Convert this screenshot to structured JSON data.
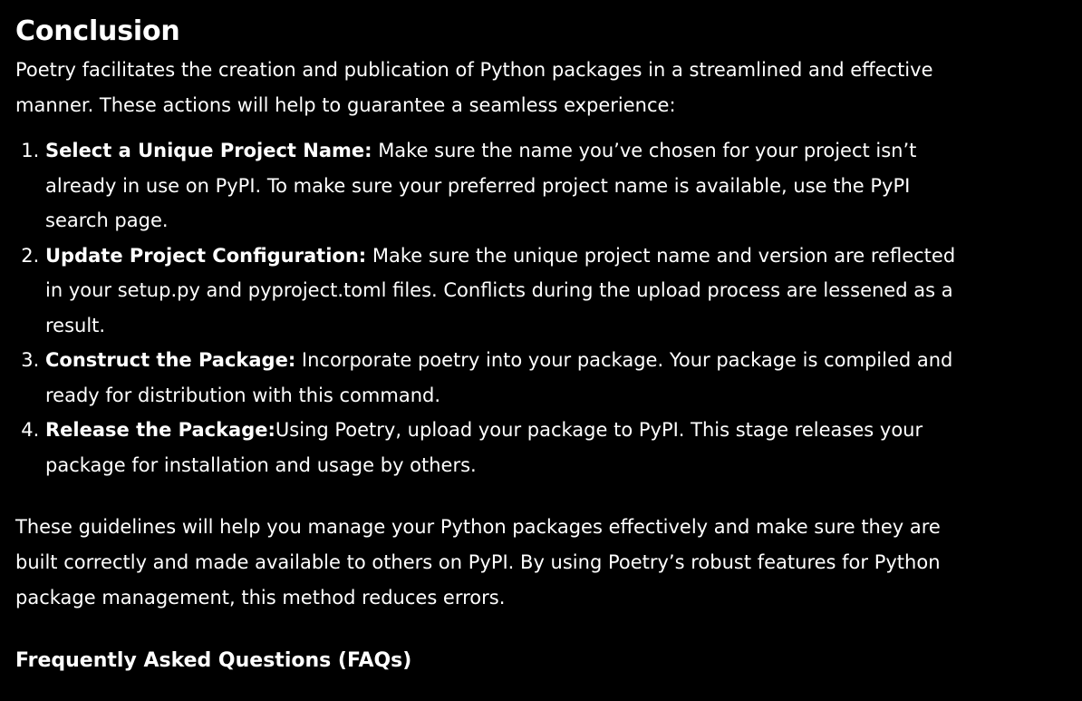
{
  "heading": "Conclusion",
  "intro": "Poetry facilitates the creation and publication of Python packages in a streamlined and effective manner. These actions will help to guarantee a seamless experience:",
  "steps": [
    {
      "title": "Select a Unique Project Name:",
      "text": " Make sure the name you’ve chosen for your project isn’t already in use on PyPI. To make sure your preferred project name is available, use the PyPI search page."
    },
    {
      "title": "Update Project Configuration:",
      "text": " Make sure the unique project name and version are reflected in your setup.py and pyproject.toml files. Conflicts during the upload process are lessened as a result."
    },
    {
      "title": "Construct the Package:",
      "text": " Incorporate poetry into your package. Your package is compiled and ready for distribution with this command."
    },
    {
      "title": "Release the Package:",
      "text": "Using Poetry, upload your package to PyPI. This stage releases your package for installation and usage by others."
    }
  ],
  "closing": "These guidelines will help you manage your Python packages effectively and make sure they are built correctly and made available to others on PyPI. By using Poetry’s robust features for Python package management, this method reduces errors.",
  "faq_heading": "Frequently Asked Questions (FAQs)"
}
